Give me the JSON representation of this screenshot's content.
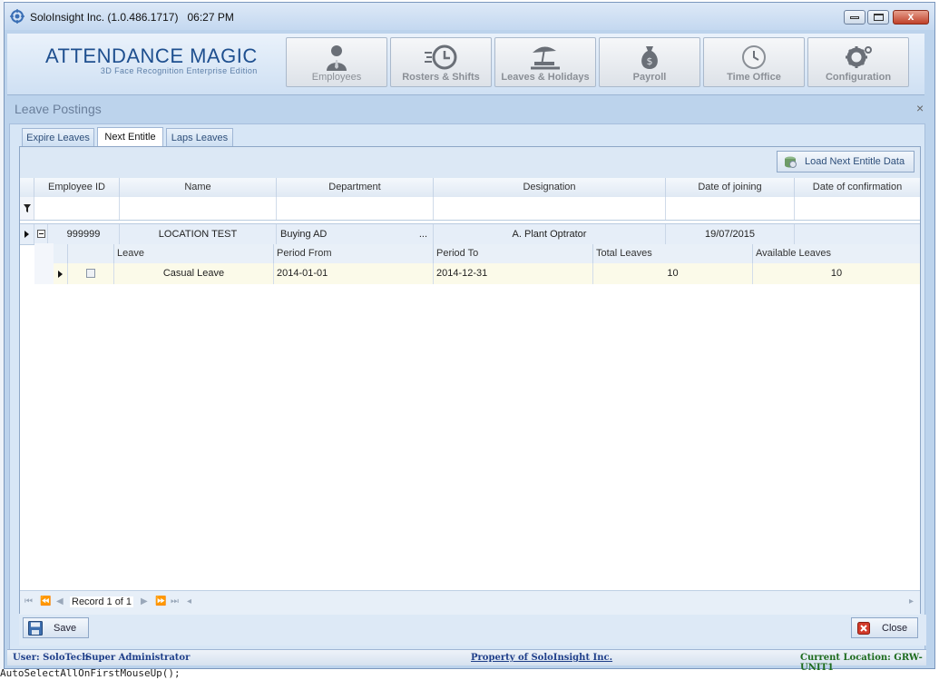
{
  "window": {
    "title": "SoloInsight Inc. (1.0.486.1717)",
    "time": "06:27 PM",
    "controls": {
      "close": "x"
    }
  },
  "logo": {
    "title": "ATTENDANCE MAGIC",
    "subtitle": "3D Face Recognition Enterprise Edition"
  },
  "nav": {
    "items": [
      {
        "label": "Employees",
        "icon": "employee-icon"
      },
      {
        "label": "Rosters & Shifts",
        "icon": "clock-icon"
      },
      {
        "label": "Leaves & Holidays",
        "icon": "beach-icon"
      },
      {
        "label": "Payroll",
        "icon": "money-bag-icon"
      },
      {
        "label": "Time Office",
        "icon": "wall-clock-icon"
      },
      {
        "label": "Configuration",
        "icon": "gear-icon"
      }
    ]
  },
  "panel": {
    "title": "Leave Postings",
    "close": "×"
  },
  "tabs": [
    {
      "label": "Expire Leaves",
      "active": false
    },
    {
      "label": "Next Entitle",
      "active": true
    },
    {
      "label": "Laps Leaves",
      "active": false
    }
  ],
  "toolbar": {
    "load_label": "Load Next Entitle Data"
  },
  "grid": {
    "columns": [
      "Employee ID",
      "Name",
      "Department",
      "Designation",
      "Date of joining",
      "Date of confirmation"
    ],
    "rows": [
      {
        "employee_id": "999999",
        "name": "LOCATION TEST",
        "department": "Buying AD",
        "designation": "A. Plant Optrator",
        "date_of_joining": "19/07/2015",
        "date_of_confirmation": "",
        "ellipsis": "...",
        "detail": {
          "columns": [
            "Leave",
            "Period From",
            "Period To",
            "Total Leaves",
            "Available Leaves"
          ],
          "rows": [
            {
              "leave": "Casual Leave",
              "period_from": "2014-01-01",
              "period_to": "2014-12-31",
              "total_leaves": "10",
              "available_leaves": "10"
            }
          ]
        }
      }
    ],
    "pager": {
      "record_text": "Record 1 of 1"
    }
  },
  "actions": {
    "save_label": "Save",
    "close_label": "Close"
  },
  "status": {
    "user": "User: SoloTech",
    "role": "Super Administrator",
    "property": "Property of SoloInsight Inc.",
    "location": "Current Location: GRW-UNIT1"
  },
  "colors": {
    "accent": "#1e4f8f",
    "status_green": "#1d6b1d",
    "status_blue": "#1f3f8a"
  },
  "background_code": "AutoSelectAllOnFirstMouseUp();"
}
